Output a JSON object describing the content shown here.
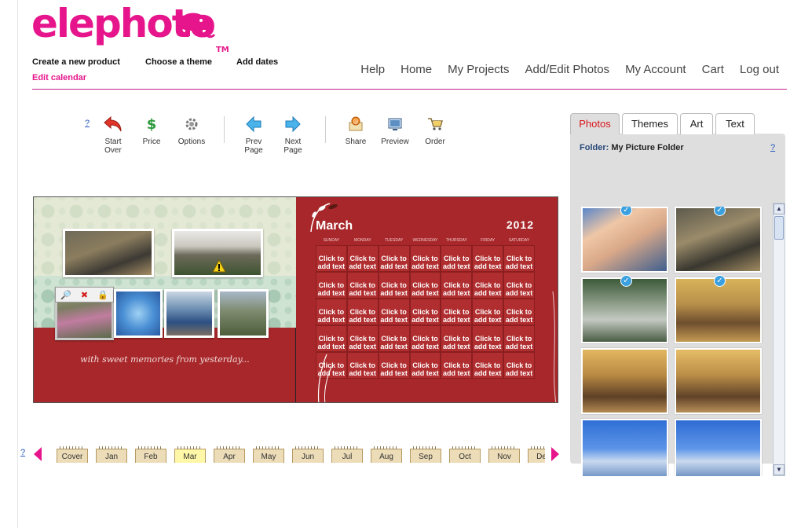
{
  "header": {
    "logo": "elephoto",
    "logo_tm": "TM",
    "steps": [
      {
        "label": "Create a new product"
      },
      {
        "label": "Choose a theme"
      },
      {
        "label": "Add dates"
      },
      {
        "label": "Edit calendar"
      }
    ],
    "nav": [
      "Help",
      "Home",
      "My Projects",
      "Add/Edit Photos",
      "My Account",
      "Cart",
      "Log out"
    ]
  },
  "toolbar": {
    "help": "?",
    "start_over_1": "Start",
    "start_over_2": "Over",
    "price": "Price",
    "options": "Options",
    "prev_1": "Prev",
    "prev_2": "Page",
    "next_1": "Next",
    "next_2": "Page",
    "share": "Share",
    "preview": "Preview",
    "order": "Order"
  },
  "calendar": {
    "quote": "with sweet memories from yesterday...",
    "month": "March",
    "year": "2012",
    "days": [
      "SUNDAY",
      "MONDAY",
      "TUESDAY",
      "WEDNESDAY",
      "THURSDAY",
      "FRIDAY",
      "SATURDAY"
    ],
    "cell_text": "Click to add text",
    "photo_tools": [
      "🔎",
      "✖",
      "🔒"
    ]
  },
  "month_tabs": {
    "help": "?",
    "tabs": [
      "Cover",
      "Jan",
      "Feb",
      "Mar",
      "Apr",
      "May",
      "Jun",
      "Jul",
      "Aug",
      "Sep",
      "Oct",
      "Nov",
      "Dec"
    ],
    "selected": "Mar"
  },
  "panel": {
    "tabs": [
      "Photos",
      "Themes",
      "Art",
      "Text"
    ],
    "selected_tab": "Photos",
    "folder_label": "Folder:",
    "folder_name": "My Picture Folder",
    "help": "?",
    "check": "✓",
    "scroll_up": "▲",
    "scroll_down": "▼"
  },
  "colors": {
    "brand": "#e6158b",
    "calendar_red": "#a8272a",
    "panel_grey": "#dedede",
    "selected_tab_text": "#d9161b"
  }
}
